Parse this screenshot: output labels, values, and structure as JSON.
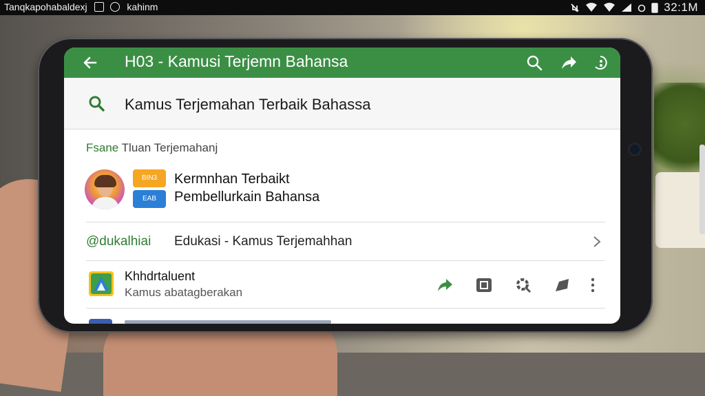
{
  "status_bar": {
    "left_text": "Tanqkapohabaldexj",
    "left_secondary": "kahinm",
    "time": "32:1M"
  },
  "app_bar": {
    "title": "H03 - Kamusi Terjemn Bahansa",
    "icons": [
      "back-arrow-icon",
      "search-icon",
      "share-icon",
      "more-icon"
    ]
  },
  "search": {
    "value": "Kamus Terjemahan Terbaik Bahassa"
  },
  "section": {
    "label_accent": "Fsane",
    "label_rest": "Tluan Terjemahanj"
  },
  "featured": {
    "line1": "Kermnhan Terbaikt",
    "line2": "Pembellurkain Bahansa",
    "thumb_top": "BIN3",
    "thumb_bottom": "EAB"
  },
  "category": {
    "label": "@dukalhiai",
    "text": "Edukasi - Kamus Terjemahhan"
  },
  "app_row": {
    "name": "Khhdrtaluent",
    "subtitle": "Kamus abatagberakan",
    "actions": [
      "forward-icon",
      "crop-icon",
      "settings-icon",
      "tag-icon",
      "more-vert-icon"
    ]
  },
  "colors": {
    "accent": "#3b8f45",
    "accent_text": "#2e7d32"
  }
}
